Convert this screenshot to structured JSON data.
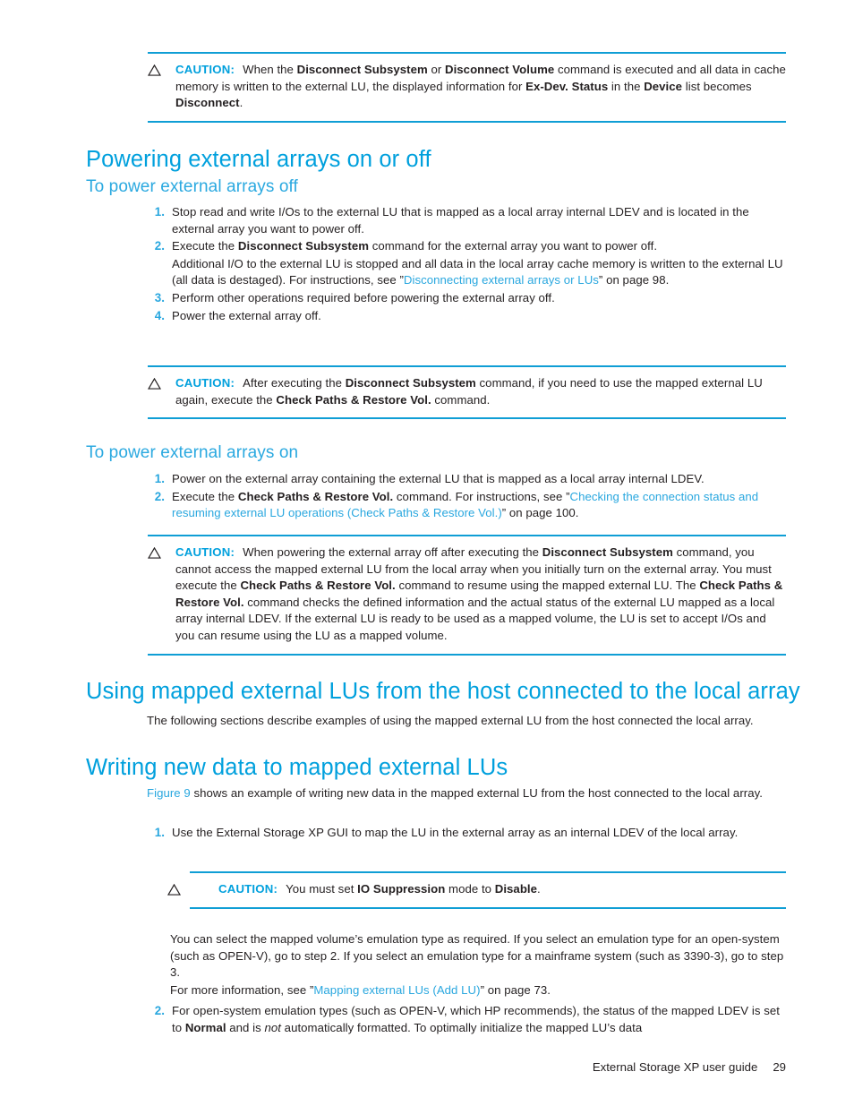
{
  "document": {
    "footer_title": "External Storage XP user guide",
    "page_number": "29"
  },
  "colors": {
    "heading": "#00a0dd",
    "subheading": "#2ba9e0",
    "link": "#29a7df",
    "rule": "#0f9ed5",
    "body": "#231f20"
  },
  "caution_label": "CAUTION:",
  "cautions": {
    "c1": {
      "p1": "When the ",
      "b1": "Disconnect Subsystem",
      "p2": " or ",
      "b2": "Disconnect Volume",
      "p3": " command is executed and all data in cache memory is written to the external LU, the displayed information for ",
      "b3": "Ex-Dev. Status",
      "p4": " in the ",
      "b4": "Device",
      "p5": " list becomes ",
      "b5": "Disconnect",
      "p6": "."
    },
    "c2": {
      "p1": "After executing the ",
      "b1": "Disconnect Subsystem",
      "p2": " command, if you need to use the mapped external LU again, execute the ",
      "b2": "Check Paths & Restore Vol.",
      "p3": " command."
    },
    "c3": {
      "p1": "When powering the external array off after executing the ",
      "b1": "Disconnect Subsystem",
      "p2": " command, you cannot access the mapped external LU from the local array when you initially turn on the external array. You must execute the ",
      "b2": "Check Paths & Restore Vol.",
      "p3": " command to resume using the mapped external LU. The ",
      "b3": "Check Paths & Restore Vol.",
      "p4": " command checks the defined information and the actual status of the external LU mapped as a local array internal LDEV. If the external LU is ready to be used as a mapped volume, the LU is set to accept I/Os and you can resume using the LU as a mapped volume."
    },
    "c4": {
      "p1": "You must set ",
      "b1": "IO Suppression",
      "p2": " mode to ",
      "b2": "Disable",
      "p3": "."
    }
  },
  "sections": {
    "powering": {
      "title": "Powering external arrays on or off",
      "off_title": "To power external arrays off",
      "off_steps": [
        {
          "num": "1.",
          "text": "Stop read and write I/Os to the external LU that is mapped as a local array internal LDEV and is located in the external array you want to power off."
        },
        {
          "num": "2.",
          "lead_p1": "Execute the ",
          "lead_b1": "Disconnect Subsystem",
          "lead_p2": " command for the external array you want to power off.",
          "cont_p1": "Additional I/O to the external LU is stopped and all data in the local array cache memory is written to the external LU (all data is destaged). For instructions, see ”",
          "cont_link": "Disconnecting external arrays or LUs",
          "cont_p2": "” on page 98."
        },
        {
          "num": "3.",
          "text": "Perform other operations required before powering the external array off."
        },
        {
          "num": "4.",
          "text": "Power the external array off."
        }
      ],
      "on_title": "To power external arrays on",
      "on_steps": [
        {
          "num": "1.",
          "text": "Power on the external array containing the external LU that is mapped as a local array internal LDEV."
        },
        {
          "num": "2.",
          "lead_p1": "Execute the ",
          "lead_b1": "Check Paths & Restore Vol.",
          "lead_p2": " command. For instructions, see ”",
          "lead_link": "Checking the connection status and resuming external LU operations (Check Paths & Restore Vol.)",
          "lead_p3": "” on page 100."
        }
      ]
    },
    "using": {
      "title": "Using mapped external LUs from the host connected to the local array",
      "intro": "The following sections describe examples of using the mapped external LU from the host connected the local array."
    },
    "writing": {
      "title": "Writing new data to mapped external LUs",
      "intro_link": "Figure 9",
      "intro_rest": " shows an example of writing new data in the mapped external LU from the host connected to the local array.",
      "step1_num": "1.",
      "step1_text": "Use the External Storage XP GUI to map the LU in the external array as an internal LDEV of the local array.",
      "after_caution_p1": "You can select the mapped volume’s emulation type as required. If you select an emulation type for an open-system (such as OPEN-V), go to step 2. If you select an emulation type for a mainframe system (such as 3390-3), go to step 3.",
      "after_caution_p2_lead": "For more information, see ”",
      "after_caution_p2_link": "Mapping external LUs (Add LU)",
      "after_caution_p2_tail": "” on page 73.",
      "step2_num": "2.",
      "step2_p1": "For open-system emulation types (such as OPEN-V, which HP recommends), the status of the mapped LDEV is set to ",
      "step2_b1": "Normal",
      "step2_p2": " and is ",
      "step2_i1": "not",
      "step2_p3": " automatically formatted. To optimally initialize the mapped LU’s data"
    }
  }
}
